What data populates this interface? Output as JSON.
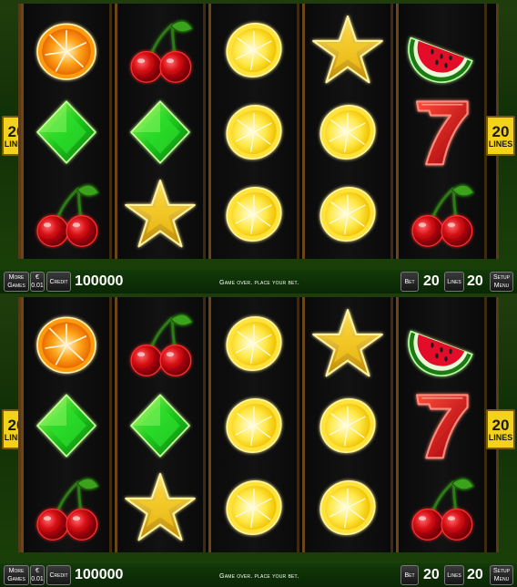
{
  "lines_badge": {
    "number": "20",
    "label": "LINES"
  },
  "symbols": {
    "orange": "orange-icon",
    "cherry": "cherry-icon",
    "lemon": "lemon-icon",
    "star": "star-icon",
    "watermelon": "watermelon-icon",
    "diamond": "diamond-icon",
    "seven": "seven-icon"
  },
  "reel_grid": [
    [
      "orange",
      "diamond",
      "cherry"
    ],
    [
      "cherry",
      "diamond",
      "star"
    ],
    [
      "lemon",
      "lemon",
      "lemon"
    ],
    [
      "star",
      "lemon",
      "lemon"
    ],
    [
      "watermelon",
      "seven",
      "cherry"
    ]
  ],
  "bottom_bar": {
    "more_games": "More\nGames",
    "currency": "€\n0.01",
    "credit_label": "Credit",
    "credit_value": "100000",
    "message": "Game over. place your bet.",
    "bet_label": "Bet",
    "bet_value": "20",
    "lines_label": "Lines",
    "lines_value": "20",
    "setup_menu": "Setup\nMenu"
  },
  "colors": {
    "panel_green": "#1c4109",
    "badge_yellow": "#f2d21a",
    "reel_frame": "#6b4516"
  }
}
